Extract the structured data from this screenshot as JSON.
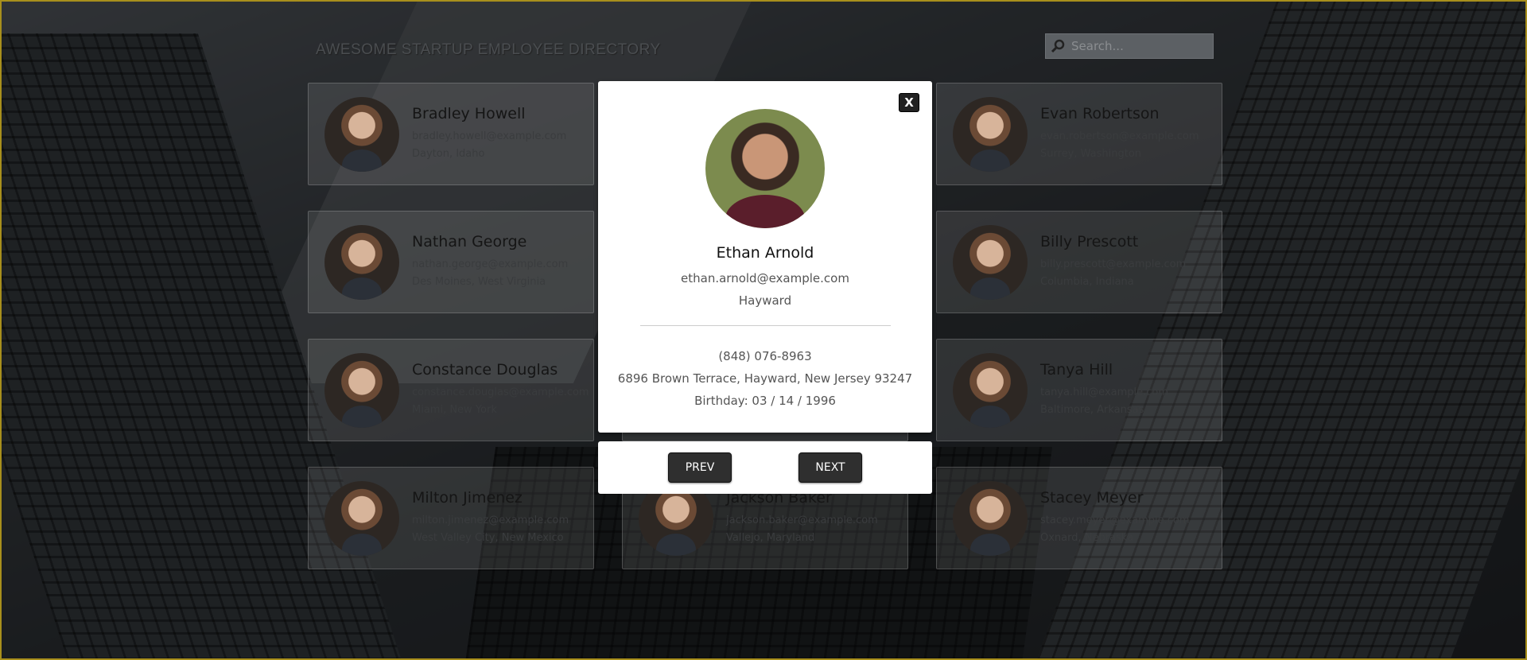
{
  "header": {
    "title": "AWESOME STARTUP EMPLOYEE DIRECTORY"
  },
  "search": {
    "placeholder": "Search..."
  },
  "employees": [
    {
      "name": "Bradley Howell",
      "email": "bradley.howell@example.com",
      "location": "Dayton, Idaho"
    },
    {
      "name": "",
      "email": "",
      "location": ""
    },
    {
      "name": "Evan Robertson",
      "email": "evan.robertson@example.com",
      "location": "Surrey, Washington"
    },
    {
      "name": "Nathan George",
      "email": "nathan.george@example.com",
      "location": "Des Moines, West Virginia"
    },
    {
      "name": "",
      "email": "",
      "location": ""
    },
    {
      "name": "Billy Prescott",
      "email": "billy.prescott@example.com",
      "location": "Columbia, Indiana"
    },
    {
      "name": "Constance Douglas",
      "email": "constance.douglas@example.com",
      "location": "Miami, New York"
    },
    {
      "name": "",
      "email": "",
      "location": ""
    },
    {
      "name": "Tanya Hill",
      "email": "tanya.hill@example.com",
      "location": "Baltimore, Arkansas"
    },
    {
      "name": "Milton Jimenez",
      "email": "milton.jimenez@example.com",
      "location": "West Valley City, New Mexico"
    },
    {
      "name": "Jackson Baker",
      "email": "jackson.baker@example.com",
      "location": "Vallejo, Maryland"
    },
    {
      "name": "Stacey Meyer",
      "email": "stacey.meyer@example.com",
      "location": "Oxnard, Nebraska"
    }
  ],
  "modal": {
    "close_label": "X",
    "name": "Ethan Arnold",
    "email": "ethan.arnold@example.com",
    "city": "Hayward",
    "phone": "(848) 076-8963",
    "address": "6896 Brown Terrace, Hayward, New Jersey 93247",
    "birthday": "Birthday: 03 / 14 / 1996",
    "prev_label": "PREV",
    "next_label": "NEXT"
  }
}
